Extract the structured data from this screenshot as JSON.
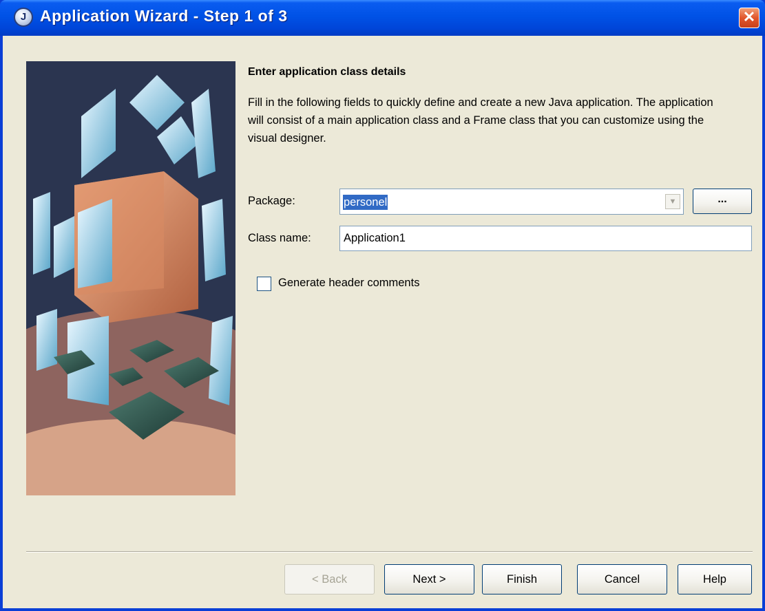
{
  "window": {
    "title": "Application Wizard - Step 1 of 3",
    "icon_letter": "J",
    "close_glyph": "✕"
  },
  "content": {
    "heading": "Enter application class details",
    "description": "Fill in the following fields to quickly define and create a new Java application. The application will consist of a main application class and a Frame class that you can customize using the visual designer."
  },
  "form": {
    "package_label": "Package:",
    "package_value": "personel",
    "browse_label": "...",
    "class_name_label": "Class name:",
    "class_name_value": "Application1",
    "generate_comments_label": "Generate header comments",
    "generate_comments_checked": false
  },
  "buttons": {
    "back": "< Back",
    "next": "Next >",
    "finish": "Finish",
    "cancel": "Cancel",
    "help": "Help"
  },
  "colors": {
    "titlebar": "#0054e3",
    "dialog_bg": "#ece9d8",
    "selection": "#316ac5",
    "close_button": "#e2562c"
  }
}
